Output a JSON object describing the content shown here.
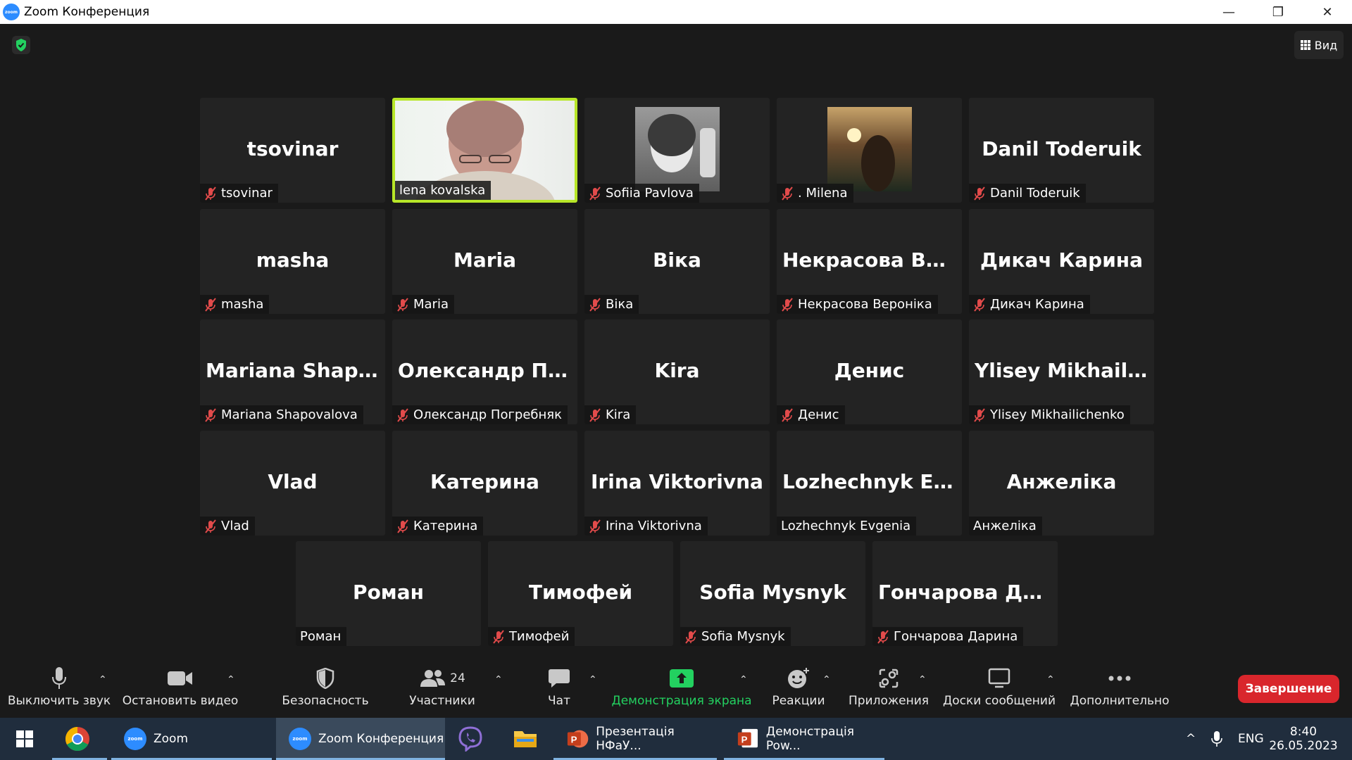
{
  "window": {
    "title": "Zoom Конференция",
    "logo_text": "zoom",
    "minimize_icon": "—",
    "restore_icon": "❐",
    "close_icon": "✕"
  },
  "top": {
    "view_label": "Вид",
    "security_color": "#23d160"
  },
  "colors": {
    "active_border": "#b7e628",
    "muted_mic": "#e24b4b",
    "share_green": "#23d160",
    "end_red": "#d9262c"
  },
  "participants": [
    {
      "big": "tsovinar",
      "label": "tsovinar",
      "muted": true
    },
    {
      "big": "",
      "label": "lena kovalska",
      "muted": false,
      "video": true,
      "active": true
    },
    {
      "big": "",
      "label": "Sofiia Pavlova",
      "muted": true,
      "avatar": true
    },
    {
      "big": "",
      "label": ". Milena",
      "muted": true,
      "avatar": true
    },
    {
      "big": "Danil Toderuik",
      "label": "Danil Toderuik",
      "muted": true
    },
    {
      "big": "masha",
      "label": "masha",
      "muted": true
    },
    {
      "big": "Maria",
      "label": "Maria",
      "muted": true
    },
    {
      "big": "Віка",
      "label": "Віка",
      "muted": true
    },
    {
      "big": "Некрасова  Вер...",
      "label": "Некрасова Вероніка",
      "muted": true
    },
    {
      "big": "Дикач Карина",
      "label": "Дикач Карина",
      "muted": true
    },
    {
      "big": "Mariana  Shapo...",
      "label": "Mariana Shapovalova",
      "muted": true
    },
    {
      "big": "Олександр  Пог...",
      "label": "Олександр Погребняк",
      "muted": true
    },
    {
      "big": "Kira",
      "label": "Kira",
      "muted": true
    },
    {
      "big": "Денис",
      "label": "Денис",
      "muted": true
    },
    {
      "big": "Ylisey  Mikhailic...",
      "label": "Ylisey Mikhailichenko",
      "muted": true
    },
    {
      "big": "Vlad",
      "label": "Vlad",
      "muted": true
    },
    {
      "big": "Катерина",
      "label": "Катерина",
      "muted": true
    },
    {
      "big": "Irina Viktorivna",
      "label": "Irina Viktorivna",
      "muted": true
    },
    {
      "big": "Lozhechnyk  Evg...",
      "label": "Lozhechnyk Evgenia",
      "muted": false
    },
    {
      "big": "Анжеліка",
      "label": "Анжеліка",
      "muted": false
    },
    {
      "big": "Роман",
      "label": "Роман",
      "muted": false
    },
    {
      "big": "Тимофей",
      "label": "Тимофей",
      "muted": true
    },
    {
      "big": "Sofia Mysnyk",
      "label": "Sofia Mysnyk",
      "muted": true
    },
    {
      "big": "Гончарова  Дар...",
      "label": "Гончарова Дарина",
      "muted": true
    }
  ],
  "toolbar": {
    "mute_label": "Выключить звук",
    "video_label": "Остановить видео",
    "security_label": "Безопасность",
    "participants_label": "Участники",
    "participants_count": "24",
    "chat_label": "Чат",
    "share_label": "Демонстрация экрана",
    "reactions_label": "Реакции",
    "apps_label": "Приложения",
    "whiteboards_label": "Доски сообщений",
    "more_label": "Дополнительно",
    "end_label": "Завершение",
    "caret": "⌃"
  },
  "taskbar": {
    "zoom_label": "Zoom",
    "zoom_meeting_label": "Zoom Конференция",
    "ppt1_label": "Презентація НФаУ...",
    "ppt2_label": "Демонстрація Pow...",
    "lang": "ENG",
    "time": "8:40",
    "date": "26.05.2023",
    "tray_caret": "^"
  }
}
